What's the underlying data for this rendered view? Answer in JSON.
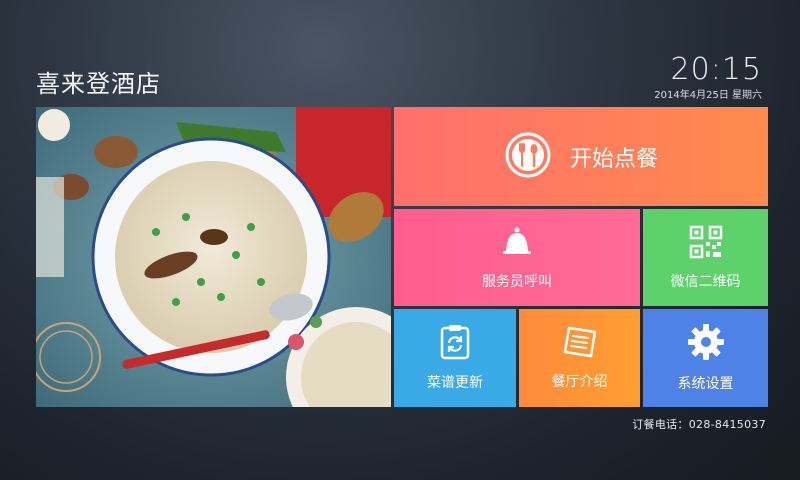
{
  "header": {
    "hotel_name": "喜来登酒店",
    "time": "20:15",
    "date": "2014年4月25日 星期六"
  },
  "hero": {
    "icon": "risotto-food-photo"
  },
  "tiles": {
    "order": {
      "label": "开始点餐",
      "icon": "plate-fork-spoon-icon",
      "color": "#ff7a5e"
    },
    "waiter": {
      "label": "服务员呼叫",
      "icon": "bell-icon",
      "color": "#ff6493"
    },
    "wechat": {
      "label": "微信二维码",
      "icon": "qr-code-icon",
      "color": "#5dd26a"
    },
    "menu": {
      "label": "菜谱更新",
      "icon": "clipboard-refresh-icon",
      "color": "#3aaae6"
    },
    "intro": {
      "label": "餐厅介绍",
      "icon": "document-icon",
      "color": "#ff9436"
    },
    "settings": {
      "label": "系统设置",
      "icon": "gear-icon",
      "color": "#4f82e6"
    }
  },
  "footer": {
    "phone_label": "订餐电话：",
    "phone_number": "028-8415037"
  }
}
